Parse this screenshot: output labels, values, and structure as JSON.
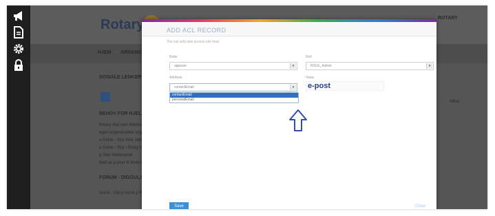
{
  "admin_rail": {
    "icons": [
      "megaphone-icon",
      "document-icon",
      "gear-icon",
      "lock-icon"
    ]
  },
  "site": {
    "logo_text": "Rotary",
    "top_right": "ROTARY",
    "nav": [
      "HJEM",
      "ARRANGEMENTER"
    ],
    "sidebar": {
      "heading_social": "SOSIALE LENKER",
      "heading_help": "BEHOV FOR HJELP?",
      "lines": [
        "Rotary mal som Manitorta",
        "egen engelskstøtte avgjennet",
        "a Guide - Styr hele sidene",
        "a Guide - Styr i Riktig Vei",
        "g Sikjr Webmaster",
        "Mail ao p post til Webmaster"
      ],
      "heading_forum": "FORUM - DIGOULA BLOGG",
      "footer_line": "Norsk - Gitt p norsk p Roe"
    },
    "right_word": "Mher"
  },
  "modal": {
    "title": "ADD ACL RECORD",
    "description": "You can add new access rule here",
    "labels": {
      "role": "Rolle",
      "right": "Roll",
      "attribute": "Attribute",
      "value": "Value"
    },
    "role_select": "appuser",
    "right_select": "ROLE_Admin",
    "attribute_select": "contactEmail",
    "attribute_options": [
      "contactEmail",
      "personalEmail"
    ],
    "value_text": "e-post",
    "submit_label": "Save",
    "close_label": "Close"
  },
  "colors": {
    "accent": "#2f6fcb",
    "submit": "#3d8fd6",
    "value_text": "#2a3f8a",
    "arrow": "#2f4fb0"
  }
}
